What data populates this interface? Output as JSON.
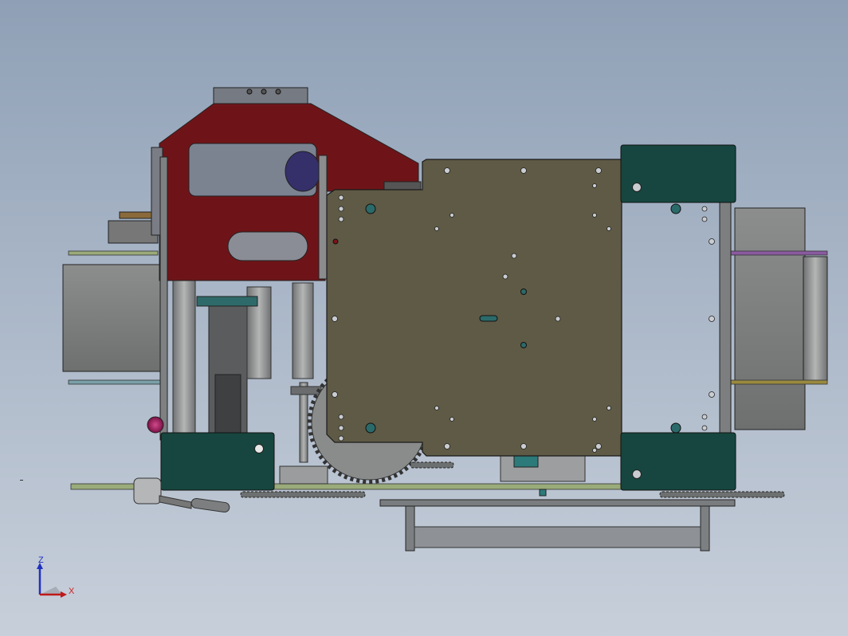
{
  "view": {
    "orientation": "front",
    "background_top": "#8fa0b6",
    "background_bottom": "#c7cfda"
  },
  "colors": {
    "frame_red": "#6e1418",
    "plate_olive": "#5e5a45",
    "block_teal": "#16463f",
    "gear_gray": "#8a8c8c",
    "steel_gray": "#7d7f80",
    "rail_green": "#9aab7a",
    "rail_purple": "#8a5aa0",
    "rail_gold": "#9a8a40",
    "knob_magenta": "#9a1a5a"
  },
  "triad": {
    "z_label": "Z",
    "x_label": "X"
  }
}
